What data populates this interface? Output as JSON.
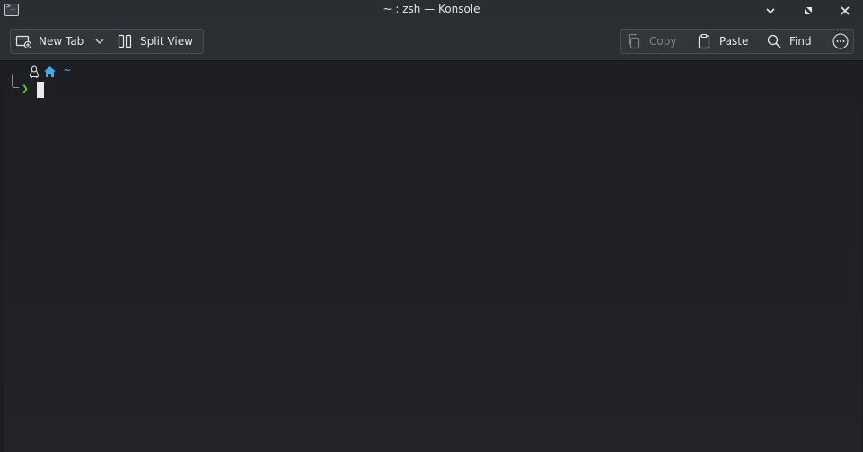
{
  "window": {
    "title": "~ : zsh — Konsole",
    "icon": "terminal-app-icon"
  },
  "toolbar": {
    "new_tab_label": "New Tab",
    "split_view_label": "Split View",
    "copy_label": "Copy",
    "paste_label": "Paste",
    "find_label": "Find"
  },
  "terminal": {
    "cwd": "~",
    "prompt_symbol": "❯",
    "os_icon": "tux-icon",
    "home_icon": "home-icon"
  },
  "colors": {
    "accent": "#3daee9",
    "prompt": "#61d01f",
    "titlebar": "#2a2e33",
    "toolbar": "#2b2f34",
    "terminal_bg": "#1e2026"
  }
}
